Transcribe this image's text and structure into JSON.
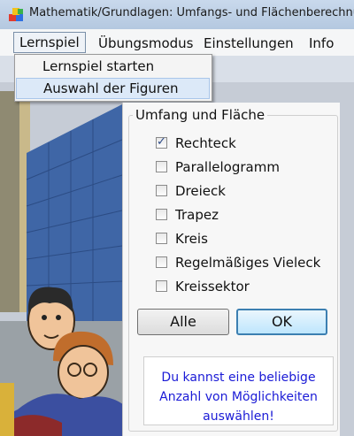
{
  "window": {
    "title": "Mathematik/Grundlagen: Umfangs- und Flächenberechnungen",
    "icon": "app-icon-cubes"
  },
  "menu": {
    "items": [
      "Lernspiel",
      "Übungsmodus",
      "Einstellungen",
      "Info"
    ],
    "open_index": 0,
    "dropdown": [
      "Lernspiel starten",
      "Auswahl der Figuren"
    ],
    "highlighted_index": 1
  },
  "dialog": {
    "group_title": "Umfang und Fläche",
    "shapes": [
      {
        "label": "Rechteck",
        "checked": true
      },
      {
        "label": "Parallelogramm",
        "checked": false
      },
      {
        "label": "Dreieck",
        "checked": false
      },
      {
        "label": "Trapez",
        "checked": false
      },
      {
        "label": "Kreis",
        "checked": false
      },
      {
        "label": "Regelmäßiges Vieleck",
        "checked": false
      },
      {
        "label": "Kreissektor",
        "checked": false
      }
    ],
    "all_button": "Alle",
    "ok_button": "OK",
    "hint": "Du kannst eine beliebige Anzahl von Möglichkeiten auswählen!",
    "hint_color": "#1a1ad6"
  },
  "background": "cartoon-city-scene"
}
